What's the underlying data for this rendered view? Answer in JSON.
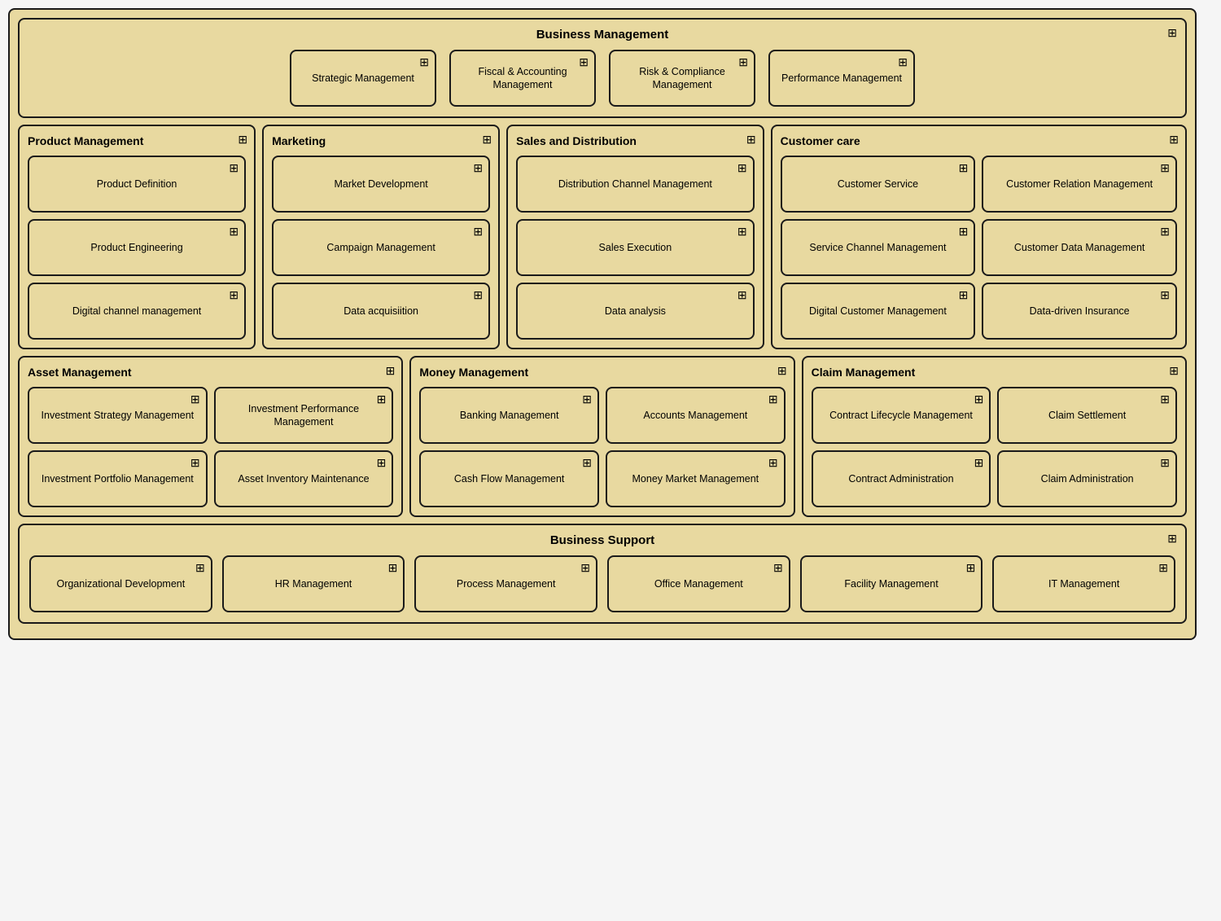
{
  "businessManagement": {
    "title": "Business Management",
    "cards": [
      {
        "label": "Strategic Management"
      },
      {
        "label": "Fiscal & Accounting Management"
      },
      {
        "label": "Risk & Compliance Management"
      },
      {
        "label": "Performance Management"
      }
    ]
  },
  "productManagement": {
    "title": "Product Management",
    "cards": [
      {
        "label": "Product Definition"
      },
      {
        "label": "Product Engineering"
      },
      {
        "label": "Digital channel management"
      }
    ]
  },
  "marketing": {
    "title": "Marketing",
    "cards": [
      {
        "label": "Market Development"
      },
      {
        "label": "Campaign Management"
      },
      {
        "label": "Data acquisiition"
      }
    ]
  },
  "salesDistribution": {
    "title": "Sales and Distribution",
    "cards": [
      {
        "label": "Distribution Channel Management"
      },
      {
        "label": "Sales Execution"
      },
      {
        "label": "Data analysis"
      }
    ]
  },
  "customerCare": {
    "title": "Customer care",
    "cards": [
      {
        "label": "Customer Service"
      },
      {
        "label": "Customer Relation Management"
      },
      {
        "label": "Service Channel Management"
      },
      {
        "label": "Customer Data Management"
      },
      {
        "label": "Digital Customer Management"
      },
      {
        "label": "Data-driven Insurance"
      }
    ]
  },
  "assetManagement": {
    "title": "Asset Management",
    "cards": [
      {
        "label": "Investment Strategy Management"
      },
      {
        "label": "Investment Performance Management"
      },
      {
        "label": "Investment Portfolio Management"
      },
      {
        "label": "Asset Inventory Maintenance"
      }
    ]
  },
  "moneyManagement": {
    "title": "Money Management",
    "cards": [
      {
        "label": "Banking Management"
      },
      {
        "label": "Accounts Management"
      },
      {
        "label": "Cash Flow Management"
      },
      {
        "label": "Money Market Management"
      }
    ]
  },
  "claimManagement": {
    "title": "Claim Management",
    "cards": [
      {
        "label": "Contract Lifecycle Management"
      },
      {
        "label": "Claim Settlement"
      },
      {
        "label": "Contract Administration"
      },
      {
        "label": "Claim Administration"
      }
    ]
  },
  "businessSupport": {
    "title": "Business Support",
    "cards": [
      {
        "label": "Organizational Development"
      },
      {
        "label": "HR Management"
      },
      {
        "label": "Process Management"
      },
      {
        "label": "Office Management"
      },
      {
        "label": "Facility Management"
      },
      {
        "label": "IT Management"
      }
    ]
  }
}
